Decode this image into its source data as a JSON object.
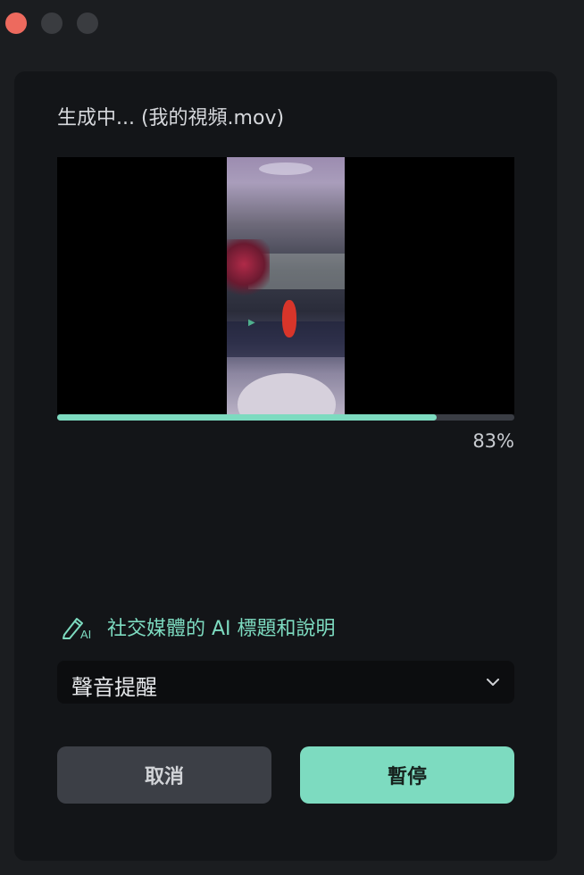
{
  "window": {
    "controls": [
      "close-button",
      "minimize-button",
      "zoom-button"
    ]
  },
  "dialog": {
    "title": "生成中... (我的視頻.mov)",
    "progress": {
      "percent_value": 83,
      "percent_label": "83%"
    },
    "ai_caption": {
      "label": "社交媒體的 AI 標題和說明",
      "icon": "ai-pen-icon"
    },
    "sound_select": {
      "value": "聲音提醒",
      "icon": "chevron-down-icon"
    },
    "buttons": {
      "cancel_label": "取消",
      "pause_label": "暫停"
    }
  },
  "colors": {
    "accent": "#7ddbc0",
    "close_light": "#ed6a5e",
    "panel_bg": "#131518",
    "window_bg": "#1b1d20",
    "cancel_bg": "#3c3f46"
  }
}
